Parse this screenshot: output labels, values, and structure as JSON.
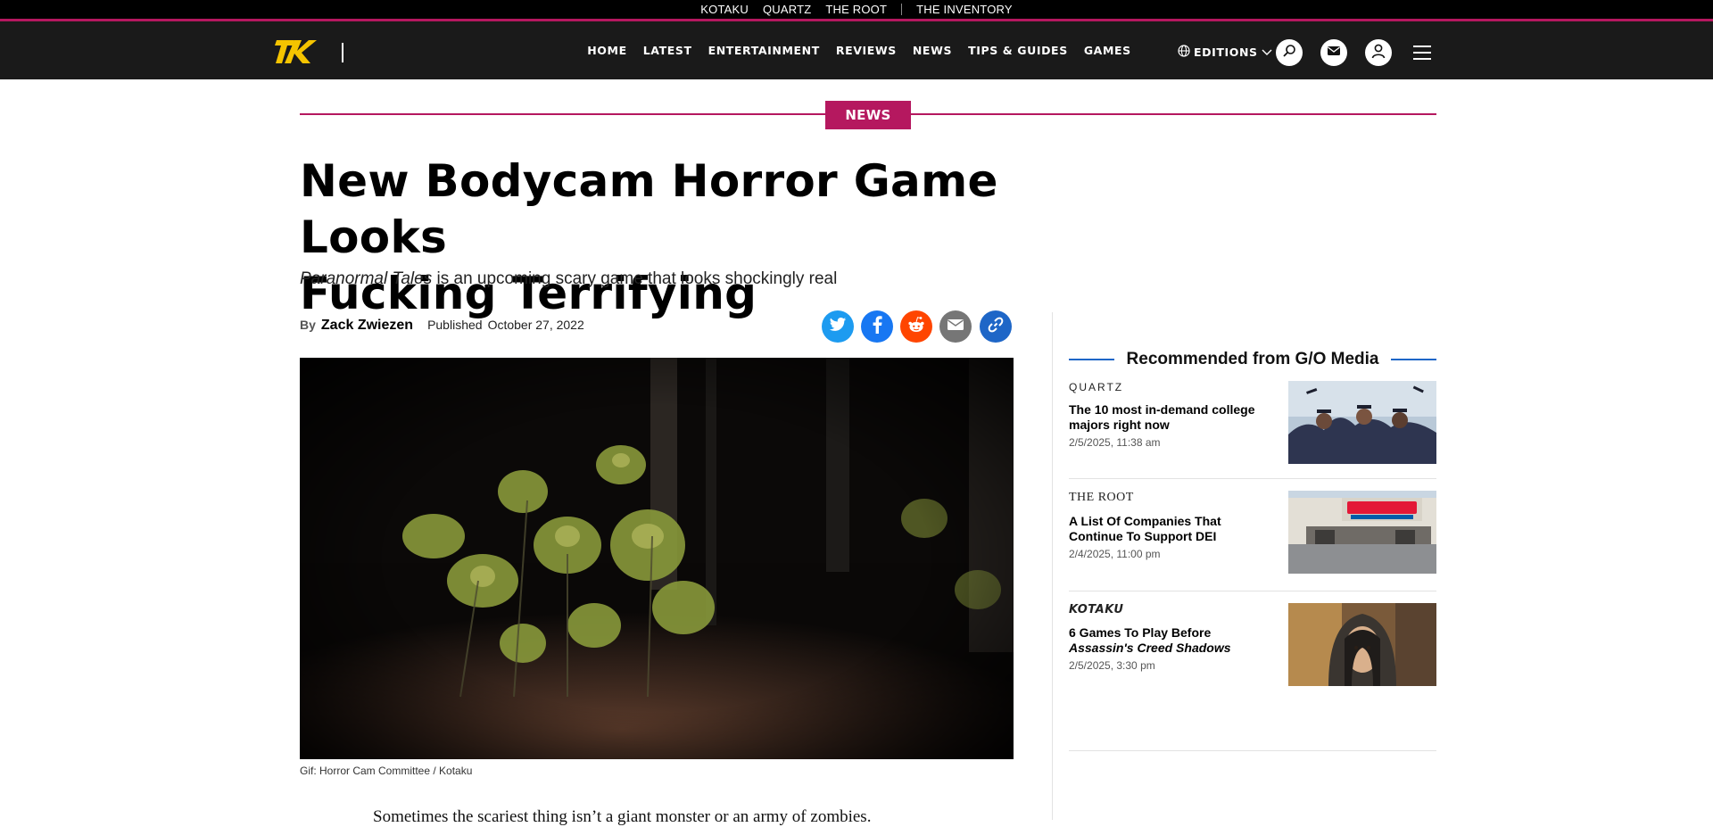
{
  "top_network": [
    "KOTAKU",
    "QUARTZ",
    "THE ROOT",
    "THE INVENTORY"
  ],
  "nav": {
    "items": [
      "HOME",
      "LATEST",
      "ENTERTAINMENT",
      "REVIEWS",
      "NEWS",
      "TIPS & GUIDES",
      "GAMES"
    ],
    "editions_label": "EDITIONS"
  },
  "article": {
    "section": "NEWS",
    "headline_line1": "New Bodycam Horror Game Looks",
    "headline_line2": "Fucking Terrifying",
    "dek_italic": "Paranormal Tales",
    "dek_rest": " is an upcoming scary game that looks shockingly real",
    "by_label": "By",
    "author": "Zack Zwiezen",
    "published_label": "Published",
    "published_date": "October 27, 2022",
    "caption": "Gif: Horror Cam Committee / Kotaku",
    "body_start": "Sometimes the scariest thing isn’t a giant monster or an army of zombies."
  },
  "share_icons": [
    "twitter-icon",
    "facebook-icon",
    "reddit-icon",
    "email-icon",
    "link-icon"
  ],
  "colors": {
    "accent": "#b5185f",
    "nav_bg": "#1a1a1a",
    "logo_yellow": "#f5c400",
    "twitter": "#1d9bf0",
    "facebook": "#1877f2",
    "reddit": "#ff4500",
    "email": "#767676",
    "link": "#1e66c7",
    "rec_line": "#1e66c7"
  },
  "recommended": {
    "heading": "Recommended from G/O Media",
    "items": [
      {
        "brand": "QUARTZ",
        "title": "The 10 most in-demand college majors right now",
        "date": "2/5/2025, 11:38 am"
      },
      {
        "brand": "THE ROOT",
        "title": "A List Of Companies That Continue To Support DEI",
        "date": "2/4/2025, 11:00 pm"
      },
      {
        "brand": "KOTAKU",
        "title_plain": "6 Games To Play Before ",
        "title_italic": "Assassin's Creed Shadows",
        "date": "2/5/2025, 3:30 pm"
      }
    ]
  }
}
